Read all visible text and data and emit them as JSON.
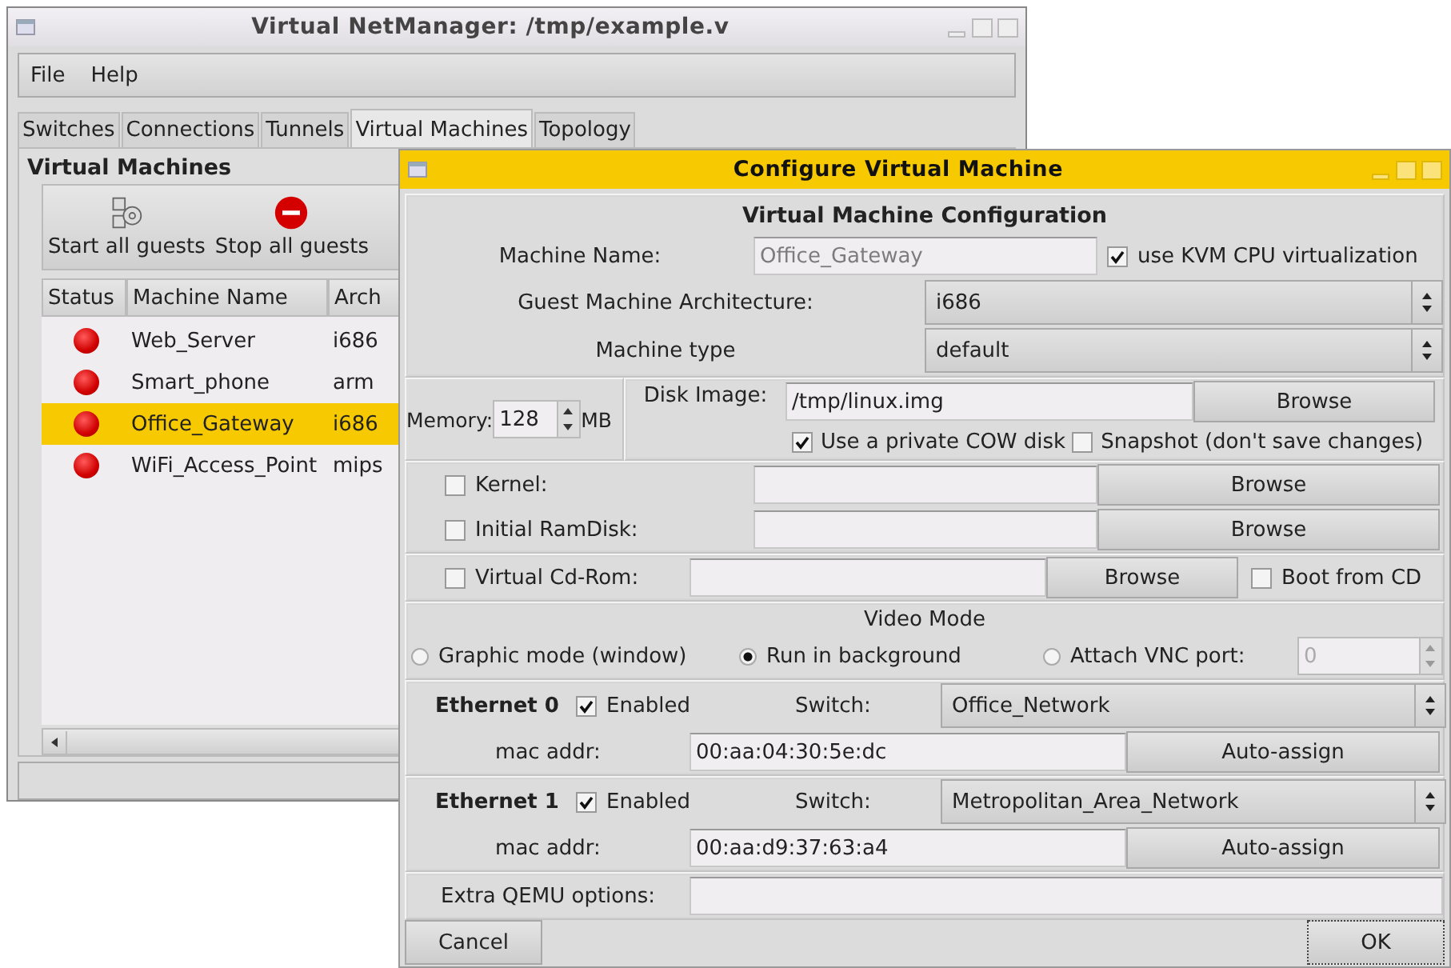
{
  "main_window": {
    "title": "Virtual NetManager: /tmp/example.v",
    "menu": [
      "File",
      "Help"
    ],
    "tabs": [
      {
        "label": "Switches",
        "selected": false
      },
      {
        "label": "Connections",
        "selected": false
      },
      {
        "label": "Tunnels",
        "selected": false
      },
      {
        "label": "Virtual Machines",
        "selected": true
      },
      {
        "label": "Topology",
        "selected": false
      }
    ],
    "section_title": "Virtual Machines",
    "toolbar": [
      {
        "label": "Start all guests",
        "kind": "start"
      },
      {
        "label": "Stop all guests",
        "kind": "stop"
      }
    ],
    "table": {
      "columns": [
        "Status",
        "Machine Name",
        "Arch"
      ],
      "rows": [
        {
          "running": false,
          "name": "Web_Server",
          "arch": "i686",
          "selected": false
        },
        {
          "running": false,
          "name": "Smart_phone",
          "arch": "arm",
          "selected": false
        },
        {
          "running": false,
          "name": "Office_Gateway",
          "arch": "i686",
          "selected": true
        },
        {
          "running": false,
          "name": "WiFi_Access_Point",
          "arch": "mips",
          "selected": false
        }
      ]
    }
  },
  "dialog": {
    "title": "Configure Virtual Machine",
    "heading": "Virtual Machine Configuration",
    "machine_name": {
      "label": "Machine Name:",
      "value": "Office_Gateway",
      "disabled": true
    },
    "kvm": {
      "label": "use KVM CPU virtualization",
      "checked": true
    },
    "arch": {
      "label": "Guest Machine Architecture:",
      "value": "i686"
    },
    "machine_type": {
      "label": "Machine type",
      "value": "default"
    },
    "memory": {
      "label": "Memory:",
      "value": "128",
      "unit": "MB"
    },
    "disk_image": {
      "label": "Disk Image:",
      "value": "/tmp/linux.img",
      "button": "Browse"
    },
    "cow": {
      "label": "Use a private COW disk",
      "checked": true
    },
    "snapshot": {
      "label": "Snapshot (don't save changes)",
      "checked": false
    },
    "kernel": {
      "label": "Kernel:",
      "checked": false,
      "button": "Browse"
    },
    "initrd": {
      "label": "Initial RamDisk:",
      "checked": false,
      "button": "Browse"
    },
    "cdrom": {
      "label": "Virtual Cd-Rom:",
      "checked": false,
      "button": "Browse"
    },
    "boot_from_cd": {
      "label": "Boot from CD",
      "checked": false
    },
    "video_mode": {
      "title": "Video Mode",
      "options": [
        {
          "label": "Graphic mode (window)",
          "selected": false
        },
        {
          "label": "Run in background",
          "selected": true
        },
        {
          "label": "Attach VNC port:",
          "selected": false
        }
      ],
      "vnc_port": {
        "value": "0",
        "disabled": true
      }
    },
    "ethernet": [
      {
        "title": "Ethernet 0",
        "enabled": {
          "label": "Enabled",
          "checked": true
        },
        "switch_label": "Switch:",
        "switch": "Office_Network",
        "mac_label": "mac addr:",
        "mac": "00:aa:04:30:5e:dc",
        "button": "Auto-assign"
      },
      {
        "title": "Ethernet 1",
        "enabled": {
          "label": "Enabled",
          "checked": true
        },
        "switch_label": "Switch:",
        "switch": "Metropolitan_Area_Network",
        "mac_label": "mac addr:",
        "mac": "00:aa:d9:37:63:a4",
        "button": "Auto-assign"
      }
    ],
    "extra_options": {
      "label": "Extra QEMU options:"
    },
    "buttons": [
      {
        "label": "Cancel",
        "kind": "cancel"
      },
      {
        "label": "OK",
        "kind": "ok"
      }
    ]
  }
}
